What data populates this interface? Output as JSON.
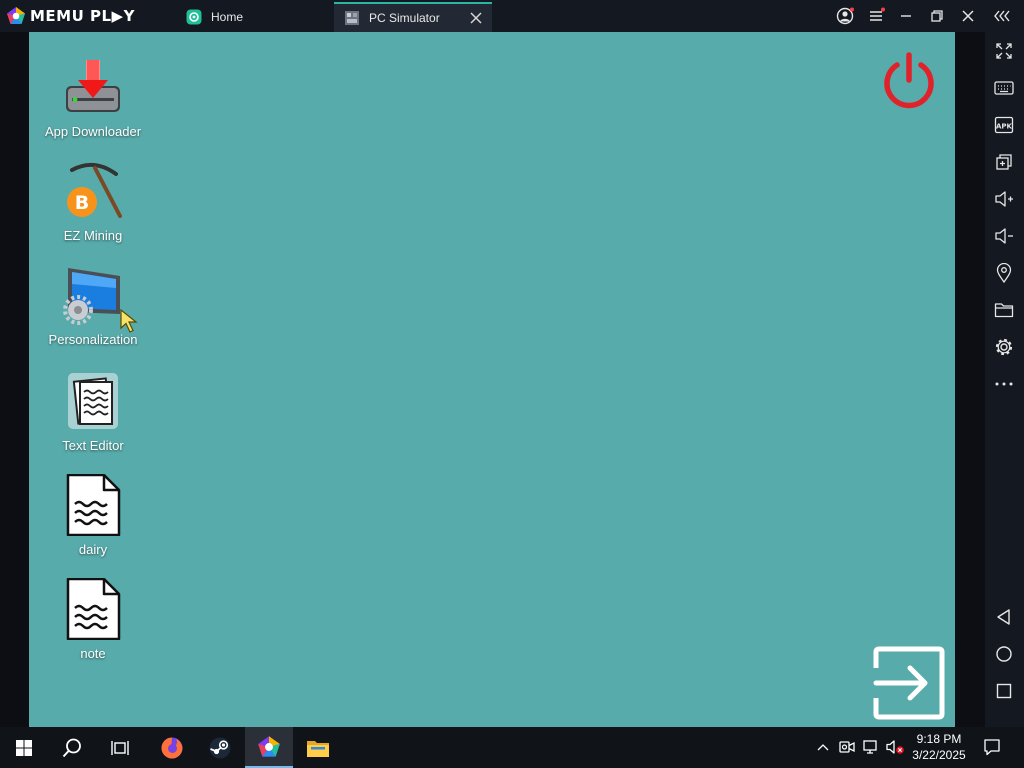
{
  "titlebar": {
    "brand": "MEMU PL▶Y",
    "tabs": [
      {
        "label": "Home",
        "icon": "memu-home-icon"
      },
      {
        "label": "PC Simulator",
        "icon": "pc-simulator-icon",
        "active": true
      }
    ]
  },
  "desktop": {
    "background": "#58abab",
    "icons": [
      {
        "label": "App Downloader",
        "icon": "app-downloader-icon"
      },
      {
        "label": "EZ Mining",
        "icon": "bitcoin-pickaxe-icon"
      },
      {
        "label": "Personalization",
        "icon": "monitor-gear-icon"
      },
      {
        "label": "Text Editor",
        "icon": "text-editor-icon"
      },
      {
        "label": "dairy",
        "icon": "text-file-icon"
      },
      {
        "label": "note",
        "icon": "text-file-icon"
      }
    ],
    "power_color": "#e0232b"
  },
  "sidebar": {
    "buttons": [
      "fullscreen-icon",
      "keyboard-icon",
      "apk-icon",
      "multi-window-icon",
      "volume-up-icon",
      "volume-down-icon",
      "location-icon",
      "folder-icon",
      "settings-icon",
      "more-icon",
      "back-icon",
      "home-circle-icon",
      "recents-icon"
    ],
    "apk_label": "APK"
  },
  "taskbar": {
    "clock_time": "9:18 PM",
    "clock_date": "3/22/2025",
    "accent": "#76b9ed"
  }
}
